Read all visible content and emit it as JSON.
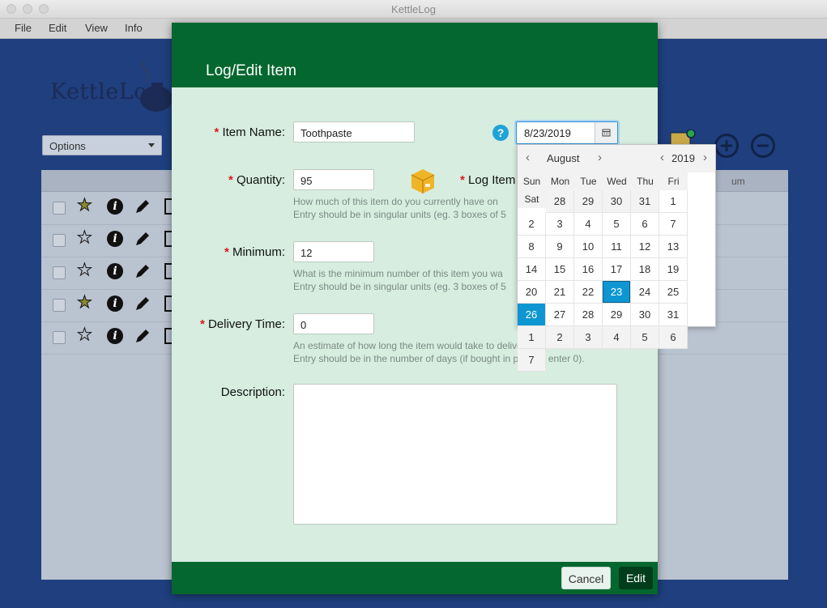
{
  "window": {
    "title": "KettleLog"
  },
  "menu": [
    "File",
    "Edit",
    "View",
    "Info"
  ],
  "background": {
    "logo_text": "KettleLog",
    "options_label": "Options",
    "column_hint": "um",
    "rows": [
      {
        "star_filled": true
      },
      {
        "star_filled": false
      },
      {
        "star_filled": false
      },
      {
        "star_filled": true
      },
      {
        "star_filled": false
      }
    ]
  },
  "dialog": {
    "title": "Log/Edit Item",
    "fields": {
      "item_name": {
        "label": "Item Name:",
        "required": true,
        "value": "Toothpaste"
      },
      "quantity": {
        "label": "Quantity:",
        "required": true,
        "value": "95",
        "help": [
          "How much of this item do you currently have on",
          "Entry should be in singular units (eg. 3 boxes of 5"
        ]
      },
      "log_item": {
        "label": "Log Item",
        "required": true
      },
      "minimum": {
        "label": "Minimum:",
        "required": true,
        "value": "12",
        "help": [
          "What is the minimum number of this item you wa",
          "Entry should be in singular units (eg. 3 boxes of 5"
        ]
      },
      "delivery_time": {
        "label": "Delivery Time:",
        "required": true,
        "value": "0",
        "help": [
          "An estimate of how long the item would take to deliver to your location.",
          "Entry should be in the number of days (if bought in person, enter 0)."
        ]
      },
      "description": {
        "label": "Description:",
        "required": false,
        "value": ""
      }
    },
    "required_marker": "*",
    "help_icon": "?",
    "date_value": "8/23/2019",
    "buttons": {
      "cancel": "Cancel",
      "edit": "Edit"
    }
  },
  "calendar": {
    "month": "August",
    "year": "2019",
    "weekdays": [
      "Sun",
      "Mon",
      "Tue",
      "Wed",
      "Thu",
      "Fri",
      "Sat"
    ],
    "weeks": [
      [
        "28",
        "29",
        "30",
        "31",
        "1",
        "2",
        "3"
      ],
      [
        "4",
        "5",
        "6",
        "7",
        "8",
        "9",
        "10"
      ],
      [
        "11",
        "12",
        "13",
        "14",
        "15",
        "16",
        "17"
      ],
      [
        "18",
        "19",
        "20",
        "21",
        "22",
        "23",
        "24"
      ],
      [
        "25",
        "26",
        "27",
        "28",
        "29",
        "30",
        "31"
      ],
      [
        "1",
        "2",
        "3",
        "4",
        "5",
        "6",
        "7"
      ]
    ],
    "other_month_cells": [
      [
        0,
        0
      ],
      [
        0,
        1
      ],
      [
        0,
        2
      ],
      [
        0,
        3
      ],
      [
        5,
        0
      ],
      [
        5,
        1
      ],
      [
        5,
        2
      ],
      [
        5,
        3
      ],
      [
        5,
        4
      ],
      [
        5,
        5
      ],
      [
        5,
        6
      ]
    ],
    "selected": "23",
    "today": "26"
  },
  "colors": {
    "header_green": "#04672f",
    "dialog_bg": "#d6ede0",
    "accent_blue": "#0d96d2",
    "app_bg": "#1f3f7e"
  }
}
